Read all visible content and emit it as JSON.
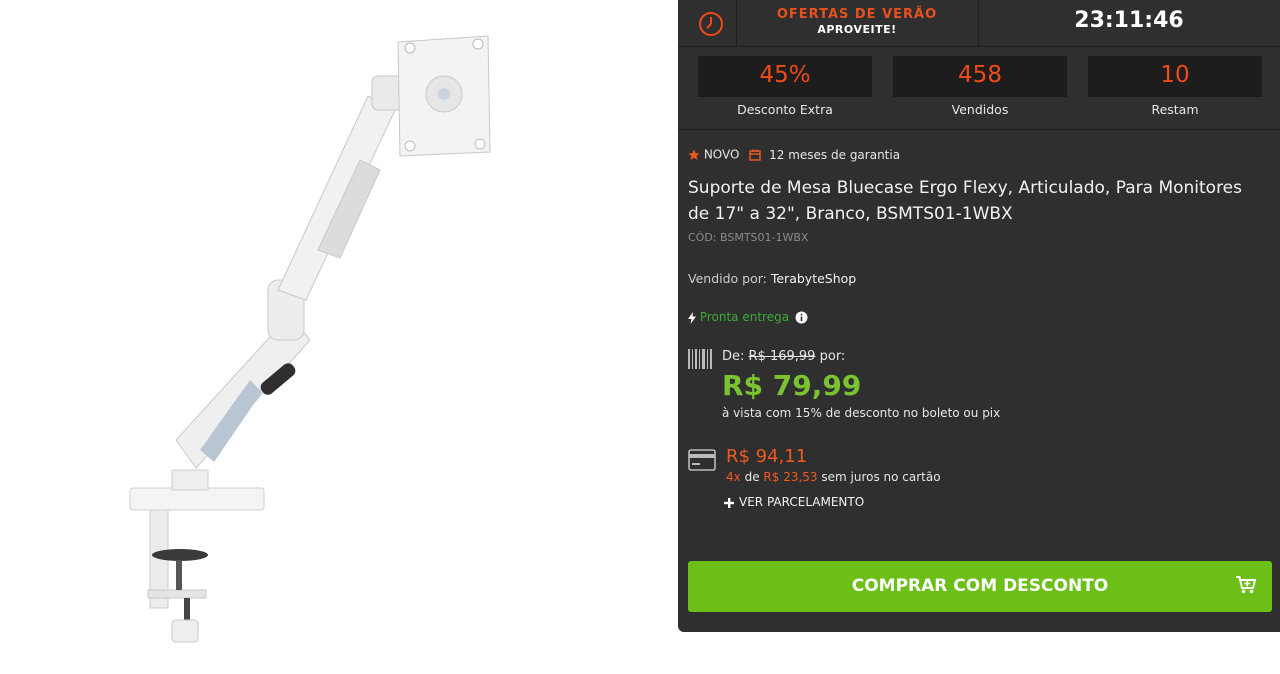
{
  "promo": {
    "title": "OFERTAS DE VERÃO",
    "subtitle": "APROVEITE!",
    "timer": "23:11:46",
    "icon": "clock-icon"
  },
  "stats": [
    {
      "value": "45%",
      "label": "Desconto Extra"
    },
    {
      "value": "458",
      "label": "Vendidos"
    },
    {
      "value": "10",
      "label": "Restam"
    }
  ],
  "badges": {
    "new": "NOVO",
    "warranty": "12 meses de garantia"
  },
  "product": {
    "title": "Suporte de Mesa Bluecase Ergo Flexy, Articulado, Para Monitores de 17\" a 32\", Branco, BSMTS01-1WBX",
    "code": "CÓD: BSMTS01-1WBX",
    "seller_prefix": "Vendido por:",
    "seller": "TerabyteShop",
    "availability": "Pronta entrega"
  },
  "pricing": {
    "old_prefix": "De:",
    "old_price": "R$ 169,99",
    "old_suffix": "por:",
    "cash_price": "R$ 79,99",
    "cash_note": "à vista com 15% de desconto no boleto ou pix",
    "card_price": "R$ 94,11",
    "install_count": "4x",
    "install_of": "de",
    "install_value": "R$ 23,53",
    "install_note": "sem juros no cartão",
    "installments_link": "VER PARCELAMENTO"
  },
  "buy_button": {
    "label": "COMPRAR COM DESCONTO"
  },
  "colors": {
    "panel_bg": "#2f2f2f",
    "accent_orange": "#ef4a17",
    "price_green": "#7ac231",
    "button_green": "#6bbf16",
    "ready_green": "#3aaa35"
  }
}
